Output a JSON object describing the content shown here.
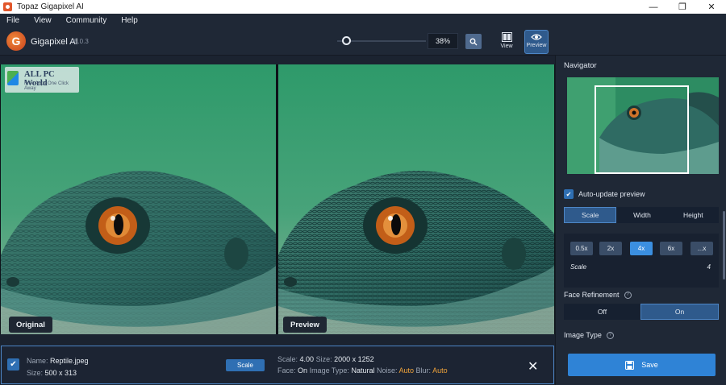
{
  "window": {
    "title": "Topaz Gigapixel AI",
    "controls": {
      "minimize": "—",
      "maximize": "❐",
      "close": "✕"
    }
  },
  "menu": [
    "File",
    "View",
    "Community",
    "Help"
  ],
  "toolbar": {
    "brand_letter": "G",
    "app_name": "Gigapixel AI",
    "version": "v5.0.3",
    "zoom_value": "38%",
    "zoom_icon": "search-icon",
    "view_label": "View",
    "preview_label": "Preview"
  },
  "panels": {
    "original_label": "Original",
    "preview_label": "Preview"
  },
  "watermark": {
    "name": "ALL PC World",
    "tagline": "Free Apps One Click Away"
  },
  "file": {
    "name_label": "Name:",
    "name_value": "Reptile.jpeg",
    "size_label": "Size:",
    "size_value": "500 x 313",
    "scale_button": "Scale",
    "scale_label": "Scale:",
    "scale_value": "4.00",
    "out_size_label": "Size:",
    "out_size_value": "2000 x 1252",
    "face_label": "Face:",
    "face_value": "On",
    "image_type_label": "Image Type:",
    "image_type_value": "Natural",
    "noise_label": "Noise:",
    "noise_value": "Auto",
    "blur_label": "Blur:",
    "blur_value": "Auto",
    "accent_color": "#f0a33a"
  },
  "sidebar": {
    "navigator_title": "Navigator",
    "auto_update_label": "Auto-update preview",
    "auto_update_checked": true,
    "dimension_tabs": [
      "Scale",
      "Width",
      "Height"
    ],
    "dimension_active": "Scale",
    "scale_options": [
      "0.5x",
      "2x",
      "4x",
      "6x",
      "...x"
    ],
    "scale_active": "4x",
    "scale_row_label": "Scale",
    "scale_row_value": "4",
    "face_refinement_title": "Face Refinement",
    "face_options": [
      "Off",
      "On"
    ],
    "face_active": "On",
    "image_type_title": "Image Type",
    "save_label": "Save"
  }
}
